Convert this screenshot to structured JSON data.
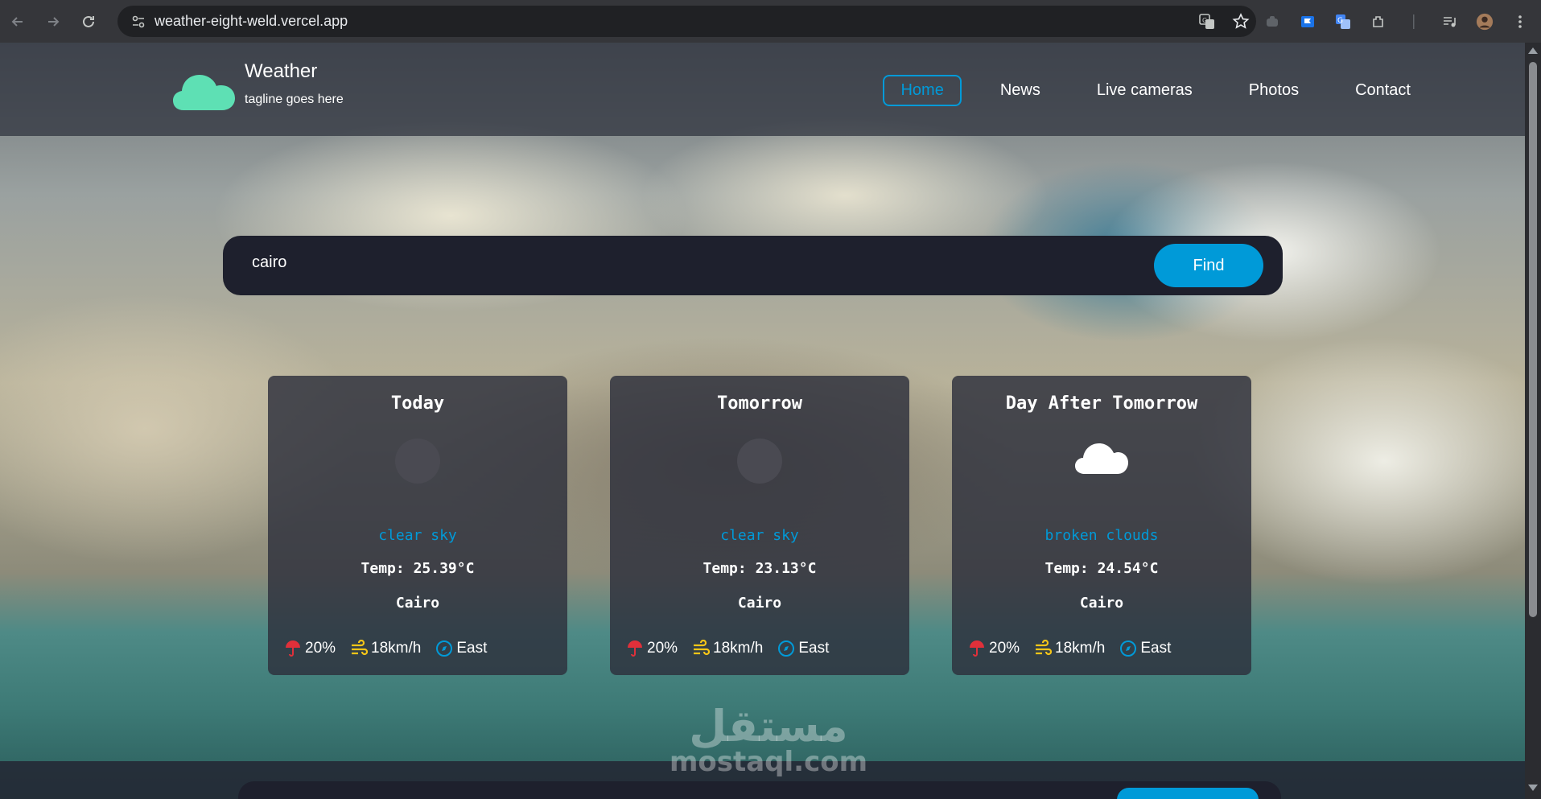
{
  "browser": {
    "url": "weather-eight-weld.vercel.app"
  },
  "site": {
    "logo_title": "Weather",
    "tagline": "tagline goes here",
    "nav": [
      {
        "label": "Home",
        "active": true
      },
      {
        "label": "News",
        "active": false
      },
      {
        "label": "Live cameras",
        "active": false
      },
      {
        "label": "Photos",
        "active": false
      },
      {
        "label": "Contact",
        "active": false
      }
    ]
  },
  "search": {
    "value": "cairo",
    "button_label": "Find"
  },
  "forecast": [
    {
      "day": "Today",
      "icon": "moon-icon",
      "description": "clear sky",
      "temp": "Temp: 25.39°C",
      "city": "Cairo",
      "rain": "20%",
      "wind": "18km/h",
      "direction": "East"
    },
    {
      "day": "Tomorrow",
      "icon": "moon-icon",
      "description": "clear sky",
      "temp": "Temp: 23.13°C",
      "city": "Cairo",
      "rain": "20%",
      "wind": "18km/h",
      "direction": "East"
    },
    {
      "day": "Day After Tomorrow",
      "icon": "cloud-icon",
      "description": "broken clouds",
      "temp": "Temp: 24.54°C",
      "city": "Cairo",
      "rain": "20%",
      "wind": "18km/h",
      "direction": "East"
    }
  ],
  "watermark": {
    "arabic": "مستقل",
    "latin": "mostaql.com"
  },
  "colors": {
    "accent": "#009ad8",
    "logo": "#5ee0b4",
    "card_bg": "#2d303c",
    "rain_icon": "#e0303a",
    "wind_icon": "#f5c518"
  }
}
